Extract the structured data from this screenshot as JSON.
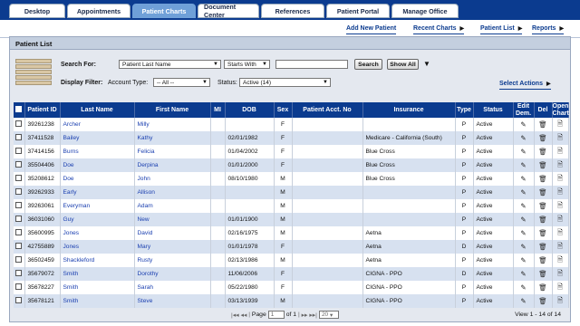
{
  "tabs": [
    {
      "label": "Desktop"
    },
    {
      "label": "Appointments"
    },
    {
      "label": "Patient Charts"
    },
    {
      "label": "Document Center"
    },
    {
      "label": "References"
    },
    {
      "label": "Patient Portal"
    },
    {
      "label": "Manage Office"
    }
  ],
  "active_tab": "Patient Charts",
  "actions": {
    "add_new_patient": "Add New Patient",
    "recent_charts": "Recent Charts",
    "patient_list": "Patient List",
    "reports": "Reports"
  },
  "panel_title": "Patient List",
  "filters": {
    "search_for_label": "Search For:",
    "search_field": "Patient Last Name",
    "match_mode": "Starts With",
    "search_value": "",
    "search_button": "Search",
    "show_all_button": "Show All",
    "display_filter_label": "Display Filter:",
    "account_type_label": "Account Type:",
    "account_type_value": "-- All --",
    "status_label": "Status:",
    "status_value": "Active (14)",
    "select_actions": "Select Actions"
  },
  "columns": [
    "Patient ID",
    "Last Name",
    "First Name",
    "MI",
    "DOB",
    "Sex",
    "Patient Acct. No",
    "Insurance",
    "Type",
    "Status",
    "Edit Dem.",
    "Del",
    "Open Chart"
  ],
  "rows": [
    {
      "id": "39261238",
      "last": "Archer",
      "first": "Milly",
      "mi": "",
      "dob": "",
      "sex": "F",
      "acct": "",
      "ins": "",
      "type": "P",
      "status": "Active"
    },
    {
      "id": "37411528",
      "last": "Bailey",
      "first": "Kathy",
      "mi": "",
      "dob": "02/01/1982",
      "sex": "F",
      "acct": "",
      "ins": "Medicare - California (South)",
      "type": "P",
      "status": "Active"
    },
    {
      "id": "37414156",
      "last": "Burns",
      "first": "Felicia",
      "mi": "",
      "dob": "01/04/2002",
      "sex": "F",
      "acct": "",
      "ins": "Blue Cross",
      "type": "P",
      "status": "Active"
    },
    {
      "id": "35504406",
      "last": "Doe",
      "first": "Derpina",
      "mi": "",
      "dob": "01/01/2000",
      "sex": "F",
      "acct": "",
      "ins": "Blue Cross",
      "type": "P",
      "status": "Active"
    },
    {
      "id": "35208612",
      "last": "Doe",
      "first": "John",
      "mi": "",
      "dob": "08/10/1980",
      "sex": "M",
      "acct": "",
      "ins": "Blue Cross",
      "type": "P",
      "status": "Active"
    },
    {
      "id": "39262933",
      "last": "Early",
      "first": "Allison",
      "mi": "",
      "dob": "",
      "sex": "M",
      "acct": "",
      "ins": "",
      "type": "P",
      "status": "Active"
    },
    {
      "id": "39263061",
      "last": "Everyman",
      "first": "Adam",
      "mi": "",
      "dob": "",
      "sex": "M",
      "acct": "",
      "ins": "",
      "type": "P",
      "status": "Active"
    },
    {
      "id": "36031060",
      "last": "Guy",
      "first": "New",
      "mi": "",
      "dob": "01/01/1900",
      "sex": "M",
      "acct": "",
      "ins": "",
      "type": "P",
      "status": "Active"
    },
    {
      "id": "35600995",
      "last": "Jones",
      "first": "David",
      "mi": "",
      "dob": "02/16/1975",
      "sex": "M",
      "acct": "",
      "ins": "Aetna",
      "type": "P",
      "status": "Active"
    },
    {
      "id": "42755889",
      "last": "Jones",
      "first": "Mary",
      "mi": "",
      "dob": "01/01/1978",
      "sex": "F",
      "acct": "",
      "ins": "Aetna",
      "type": "D",
      "status": "Active"
    },
    {
      "id": "36502459",
      "last": "Shackleford",
      "first": "Rusty",
      "mi": "",
      "dob": "02/13/1986",
      "sex": "M",
      "acct": "",
      "ins": "Aetna",
      "type": "P",
      "status": "Active"
    },
    {
      "id": "35679072",
      "last": "Smith",
      "first": "Dorothy",
      "mi": "",
      "dob": "11/06/2006",
      "sex": "F",
      "acct": "",
      "ins": "CIGNA - PPO",
      "type": "D",
      "status": "Active"
    },
    {
      "id": "35678227",
      "last": "Smith",
      "first": "Sarah",
      "mi": "",
      "dob": "05/22/1980",
      "sex": "F",
      "acct": "",
      "ins": "CIGNA - PPO",
      "type": "P",
      "status": "Active"
    },
    {
      "id": "35678121",
      "last": "Smith",
      "first": "Steve",
      "mi": "",
      "dob": "03/13/1939",
      "sex": "M",
      "acct": "",
      "ins": "CIGNA - PPO",
      "type": "P",
      "status": "Active"
    }
  ],
  "pager": {
    "page_label": "Page",
    "page_value": "1",
    "of_label": "of 1",
    "page_size": "20",
    "view_count": "View 1 - 14 of 14"
  },
  "icons": {
    "edit": "pencil-icon",
    "delete": "trash-icon",
    "open": "document-icon"
  },
  "colors": {
    "header_bar": "#0b3b8f",
    "active_tab": "#6fa0d8",
    "row_alt": "#d7e1f0",
    "link": "#1a3fb0"
  }
}
